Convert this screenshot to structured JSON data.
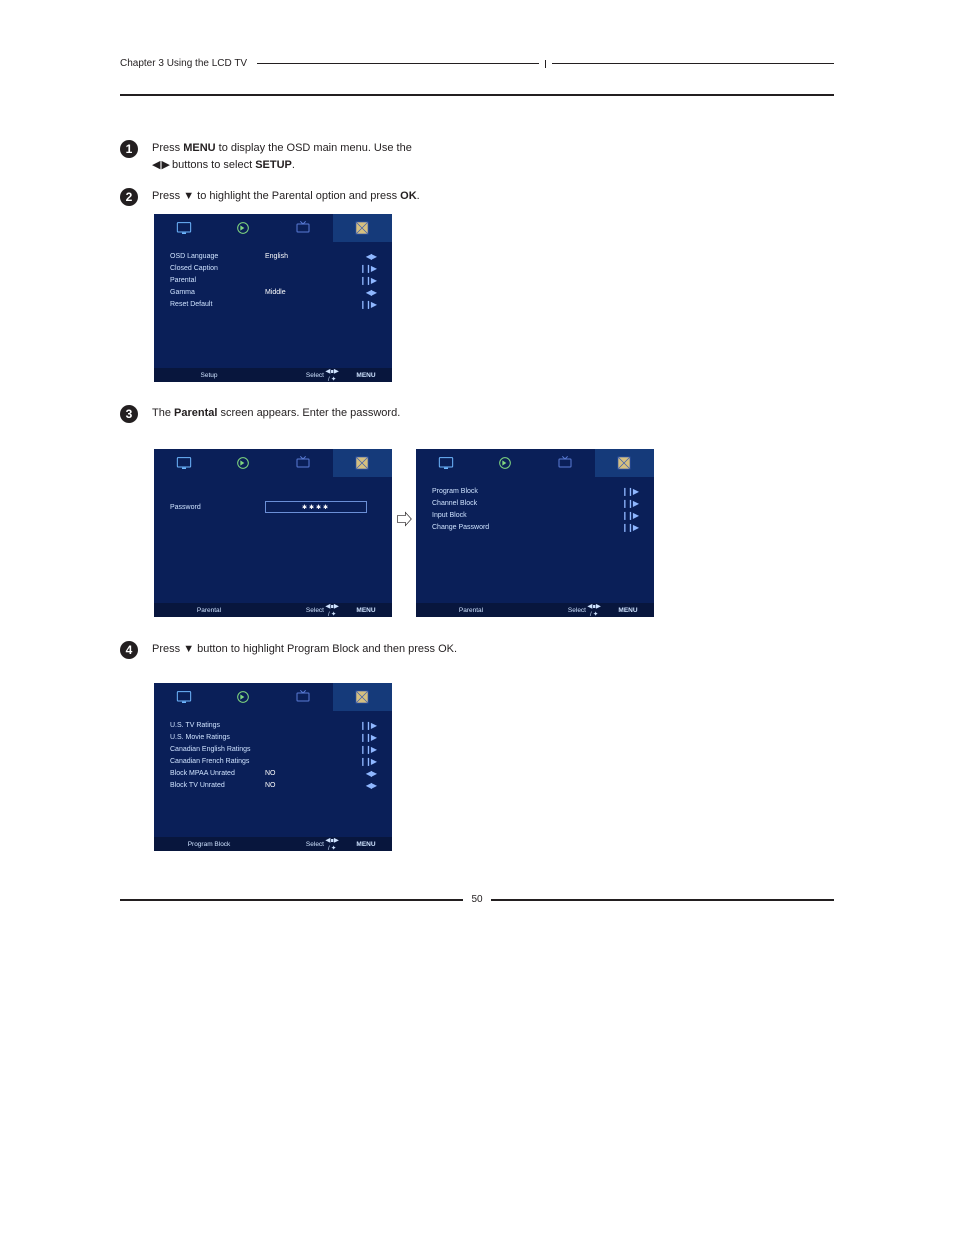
{
  "header": {
    "chapter": "Chapter 3 Using the LCD TV"
  },
  "footer": {
    "page": "50"
  },
  "steps": {
    "s1": {
      "line1_pre": "Press ",
      "menu": "MENU",
      "line1_post": " to display the OSD main menu. Use the ",
      "line2_pre": " buttons to select ",
      "setup": "SETUP",
      "line2_post": "."
    },
    "s2": {
      "pre": "Press ",
      "arrow": "▼",
      "mid": " to highlight the Parental option and press ",
      "ok": "OK",
      "post": "."
    },
    "s3": {
      "pre": "The ",
      "parental": "Parental",
      "post": " screen appears. Enter the password."
    },
    "s4": {
      "pre": "Press ",
      "arrow": "▼",
      "mid": " button to highlight ",
      "pb": "Program Block",
      "mid2": " and then press ",
      "ok": "OK",
      "post": "."
    }
  },
  "osd": {
    "footer_select": "Select",
    "footer_mid": "◀∎▶ / ✦",
    "footer_menu": "MENU",
    "setup": {
      "title": "Setup",
      "rows": [
        {
          "label": "OSD Language",
          "value": "English",
          "icon": "◀▶"
        },
        {
          "label": "Closed Caption",
          "value": "",
          "icon": "❙❙▶"
        },
        {
          "label": "Parental",
          "value": "",
          "icon": "❙❙▶"
        },
        {
          "label": "Gamma",
          "value": "Middle",
          "icon": "◀▶"
        },
        {
          "label": "Reset Default",
          "value": "",
          "icon": "❙❙▶"
        }
      ]
    },
    "password": {
      "title": "Parental",
      "label": "Password",
      "mask": "✱✱✱✱"
    },
    "parental": {
      "title": "Parental",
      "rows": [
        {
          "label": "Program Block",
          "value": "",
          "icon": "❙❙▶"
        },
        {
          "label": "Channel Block",
          "value": "",
          "icon": "❙❙▶"
        },
        {
          "label": "Input Block",
          "value": "",
          "icon": "❙❙▶"
        },
        {
          "label": "Change Password",
          "value": "",
          "icon": "❙❙▶"
        }
      ]
    },
    "program_block": {
      "title": "Program Block",
      "rows": [
        {
          "label": "U.S. TV Ratings",
          "value": "",
          "icon": "❙❙▶"
        },
        {
          "label": "U.S. Movie Ratings",
          "value": "",
          "icon": "❙❙▶"
        },
        {
          "label": "Canadian English Ratings",
          "value": "",
          "icon": "❙❙▶"
        },
        {
          "label": "Canadian French Ratings",
          "value": "",
          "icon": "❙❙▶"
        },
        {
          "label": "Block MPAA Unrated",
          "value": "NO",
          "icon": "◀▶"
        },
        {
          "label": "Block TV Unrated",
          "value": "NO",
          "icon": "◀▶"
        }
      ]
    }
  },
  "glyphs": {
    "lr": "◀ ▶"
  }
}
